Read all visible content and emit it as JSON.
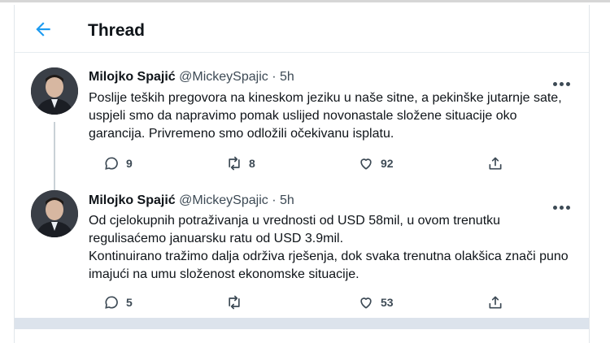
{
  "header": {
    "title": "Thread",
    "back_icon": "arrow-left-icon"
  },
  "colors": {
    "accent": "#1d9bf0",
    "text": "#0f1419",
    "secondary": "#3d4a55"
  },
  "tweets": [
    {
      "name": "Milojko Spajić",
      "handle": "@MickeySpajic",
      "separator": "·",
      "time": "5h",
      "body": [
        "Poslije teških pregovora na kineskom jeziku u naše sitne, a pekinške jutarnje sate, uspjeli smo da napravimo pomak uslijed novonastale složene situacije oko garancija. Privremeno smo odložili očekivanu isplatu."
      ],
      "replies": "9",
      "retweets": "8",
      "likes": "92"
    },
    {
      "name": "Milojko Spajić",
      "handle": "@MickeySpajic",
      "separator": "·",
      "time": "5h",
      "body": [
        "Od cjelokupnih potraživanja u vrednosti od USD 58mil, u ovom trenutku regulisaćemo januarsku ratu od USD 3.9mil.",
        "Kontinuirano tražimo dalja održiva rješenja, dok svaka trenutna olakšica znači puno imajući na umu složenost ekonomske situacije."
      ],
      "replies": "5",
      "retweets": "",
      "likes": "53"
    }
  ]
}
